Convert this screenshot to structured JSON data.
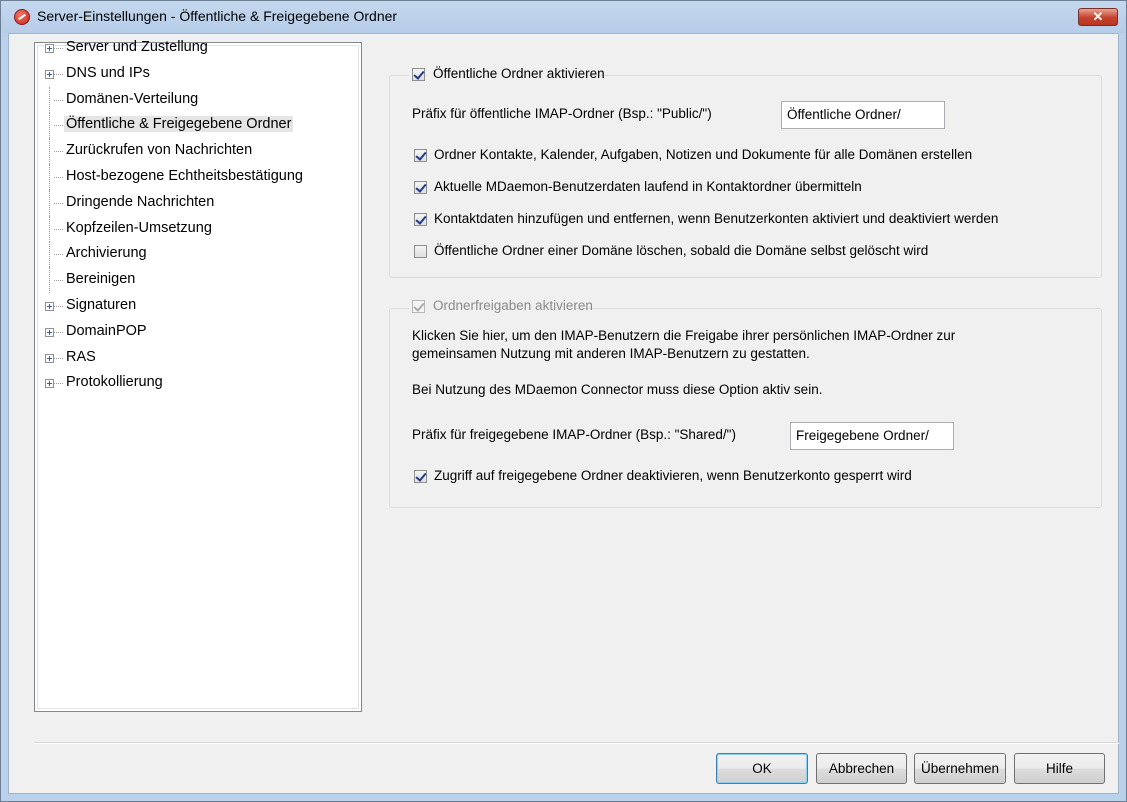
{
  "window": {
    "title": "Server-Einstellungen - Öffentliche & Freigegebene Ordner",
    "close_label": "✕"
  },
  "tree": {
    "items": [
      {
        "label": "Server und Zustellung",
        "expandable": true,
        "selected": false
      },
      {
        "label": "DNS und IPs",
        "expandable": true,
        "selected": false
      },
      {
        "label": "Domänen-Verteilung",
        "expandable": false,
        "selected": false
      },
      {
        "label": "Öffentliche & Freigegebene Ordner",
        "expandable": false,
        "selected": true
      },
      {
        "label": "Zurückrufen von Nachrichten",
        "expandable": false,
        "selected": false
      },
      {
        "label": "Host-bezogene Echtheitsbestätigung",
        "expandable": false,
        "selected": false
      },
      {
        "label": "Dringende Nachrichten",
        "expandable": false,
        "selected": false
      },
      {
        "label": "Kopfzeilen-Umsetzung",
        "expandable": false,
        "selected": false
      },
      {
        "label": "Archivierung",
        "expandable": false,
        "selected": false
      },
      {
        "label": "Bereinigen",
        "expandable": false,
        "selected": false
      },
      {
        "label": "Signaturen",
        "expandable": true,
        "selected": false
      },
      {
        "label": "DomainPOP",
        "expandable": true,
        "selected": false
      },
      {
        "label": "RAS",
        "expandable": true,
        "selected": false
      },
      {
        "label": "Protokollierung",
        "expandable": true,
        "selected": false
      }
    ]
  },
  "public_folders": {
    "enable_label": "Öffentliche Ordner aktivieren",
    "enable_checked": true,
    "prefix_label": "Präfix für öffentliche IMAP-Ordner (Bsp.: \"Public/\")",
    "prefix_value": "Öffentliche Ordner/",
    "option1_label": "Ordner Kontakte, Kalender, Aufgaben, Notizen und Dokumente für alle Domänen erstellen",
    "option1_checked": true,
    "option2_label": "Aktuelle MDaemon-Benutzerdaten laufend in Kontaktordner übermitteln",
    "option2_checked": true,
    "option3_label": "Kontaktdaten hinzufügen und entfernen, wenn Benutzerkonten aktiviert und deaktiviert werden",
    "option3_checked": true,
    "option4_label": "Öffentliche Ordner einer Domäne löschen, sobald die Domäne selbst gelöscht wird",
    "option4_checked": false
  },
  "shared_folders": {
    "enable_label": "Ordnerfreigaben aktivieren",
    "enable_checked": true,
    "enable_disabled": true,
    "description_line1": "Klicken Sie hier, um den IMAP-Benutzern die Freigabe ihrer persönlichen IMAP-Ordner zur",
    "description_line2": "gemeinsamen Nutzung mit anderen IMAP-Benutzern zu gestatten.",
    "connector_note": "Bei Nutzung des MDaemon Connector muss diese Option aktiv sein.",
    "prefix_label": "Präfix für freigegebene IMAP-Ordner (Bsp.: \"Shared/\")",
    "prefix_value": "Freigegebene Ordner/",
    "disable_access_label": "Zugriff auf freigegebene Ordner deaktivieren, wenn Benutzerkonto gesperrt wird",
    "disable_access_checked": true
  },
  "buttons": {
    "ok": "OK",
    "cancel": "Abbrechen",
    "apply": "Übernehmen",
    "help": "Hilfe"
  },
  "colors": {
    "titlebar": "#b9d1ea",
    "dialog_bg": "#f0f0f0",
    "checkmark": "#1f3a87",
    "close_button": "#c4412d"
  }
}
